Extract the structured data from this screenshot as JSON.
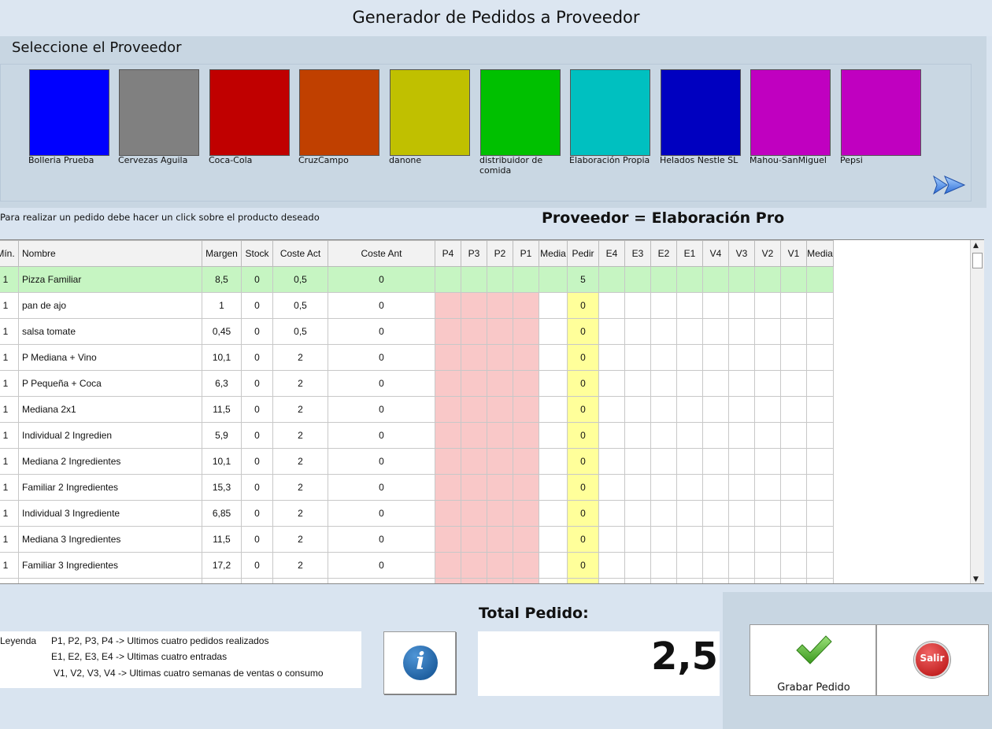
{
  "window_title": "Generador de Pedidos a Proveedor",
  "provider_section": {
    "label": "Seleccione el Proveedor",
    "providers": [
      {
        "name": "Bolleria Prueba",
        "color": "#0000ff"
      },
      {
        "name": "Cervezas Aguila",
        "color": "#808080"
      },
      {
        "name": "Coca-Cola",
        "color": "#c00000"
      },
      {
        "name": "CruzCampo",
        "color": "#c04000"
      },
      {
        "name": "danone",
        "color": "#c0c000"
      },
      {
        "name": "distribuidor de comida",
        "color": "#00c000"
      },
      {
        "name": "Elaboración Propia",
        "color": "#00c0c0"
      },
      {
        "name": "Helados Nestle SL",
        "color": "#0000c0"
      },
      {
        "name": "Mahou-SanMiguel",
        "color": "#c000c0"
      },
      {
        "name": "Pepsi",
        "color": "#c000c0"
      }
    ],
    "next_icon": "double-chevron-right-icon"
  },
  "hint": "Para realizar un pedido debe hacer un click sobre el producto deseado",
  "selected_provider": "Proveedor = Elaboración Pro",
  "grid": {
    "columns": [
      "Mín.",
      "Nombre",
      "Margen",
      "Stock",
      "Coste Act",
      "Coste Ant",
      "P4",
      "P3",
      "P2",
      "P1",
      "Media",
      "Pedir",
      "E4",
      "E3",
      "E2",
      "E1",
      "V4",
      "V3",
      "V2",
      "V1",
      "Media"
    ],
    "rows": [
      {
        "min": "1",
        "nombre": "Pizza Familiar",
        "margen": "8,5",
        "stock": "0",
        "coste_act": "0,5",
        "coste_ant": "0",
        "pedir": "5",
        "selected": true
      },
      {
        "min": "1",
        "nombre": "pan de ajo",
        "margen": "1",
        "stock": "0",
        "coste_act": "0,5",
        "coste_ant": "0",
        "pedir": "0"
      },
      {
        "min": "1",
        "nombre": "salsa tomate",
        "margen": "0,45",
        "stock": "0",
        "coste_act": "0,5",
        "coste_ant": "0",
        "pedir": "0"
      },
      {
        "min": "1",
        "nombre": "P Mediana + Vino",
        "margen": "10,1",
        "stock": "0",
        "coste_act": "2",
        "coste_ant": "0",
        "pedir": "0"
      },
      {
        "min": "1",
        "nombre": "P Pequeña + Coca",
        "margen": "6,3",
        "stock": "0",
        "coste_act": "2",
        "coste_ant": "0",
        "pedir": "0"
      },
      {
        "min": "1",
        "nombre": "Mediana 2x1",
        "margen": "11,5",
        "stock": "0",
        "coste_act": "2",
        "coste_ant": "0",
        "pedir": "0"
      },
      {
        "min": "1",
        "nombre": "Individual 2 Ingredien",
        "margen": "5,9",
        "stock": "0",
        "coste_act": "2",
        "coste_ant": "0",
        "pedir": "0"
      },
      {
        "min": "1",
        "nombre": "Mediana 2 Ingredientes",
        "margen": "10,1",
        "stock": "0",
        "coste_act": "2",
        "coste_ant": "0",
        "pedir": "0"
      },
      {
        "min": "1",
        "nombre": "Familiar 2 Ingredientes",
        "margen": "15,3",
        "stock": "0",
        "coste_act": "2",
        "coste_ant": "0",
        "pedir": "0"
      },
      {
        "min": "1",
        "nombre": "Individual 3 Ingrediente",
        "margen": "6,85",
        "stock": "0",
        "coste_act": "2",
        "coste_ant": "0",
        "pedir": "0"
      },
      {
        "min": "1",
        "nombre": "Mediana 3 Ingredientes",
        "margen": "11,5",
        "stock": "0",
        "coste_act": "2",
        "coste_ant": "0",
        "pedir": "0"
      },
      {
        "min": "1",
        "nombre": "Familiar 3 Ingredientes",
        "margen": "17,2",
        "stock": "0",
        "coste_act": "2",
        "coste_ant": "0",
        "pedir": "0"
      }
    ]
  },
  "legend": {
    "title": "Leyenda",
    "line1": "P1, P2, P3, P4 -> Ultimos cuatro pedidos realizados",
    "line2": "E1, E2, E3, E4 -> Ultimas cuatro entradas",
    "line3": "V1, V2, V3, V4 -> Ultimas cuatro semanas de ventas o consumo"
  },
  "info_button": {
    "icon": "info-icon",
    "glyph": "i"
  },
  "total": {
    "label": "Total Pedido:",
    "value": "2,5"
  },
  "grabar_button": {
    "label": "Grabar Pedido",
    "icon": "checkmark-icon"
  },
  "salir_button": {
    "label": "Salir",
    "icon": "stop-sign-icon"
  }
}
